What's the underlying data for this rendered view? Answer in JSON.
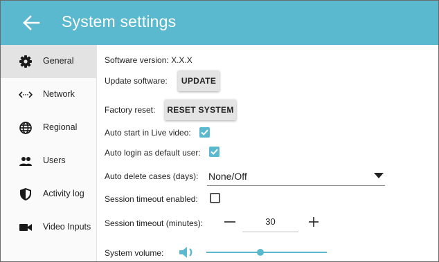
{
  "appbar": {
    "title": "System settings",
    "back_icon": "arrow-left-icon",
    "background": "#5ab8cf"
  },
  "sidebar": {
    "items": [
      {
        "label": "General",
        "icon": "gear-icon",
        "active": true
      },
      {
        "label": "Network",
        "icon": "code-dots-icon",
        "active": false
      },
      {
        "label": "Regional",
        "icon": "globe-icon",
        "active": false
      },
      {
        "label": "Users",
        "icon": "users-icon",
        "active": false
      },
      {
        "label": "Activity log",
        "icon": "shield-icon",
        "active": false
      },
      {
        "label": "Video Inputs",
        "icon": "video-camera-icon",
        "active": false
      }
    ]
  },
  "general": {
    "software_version_label": "Software version:",
    "software_version_value": "X.X.X",
    "update_label": "Update software:",
    "update_button": "UPDATE",
    "factory_reset_label": "Factory reset:",
    "reset_button": "RESET SYSTEM",
    "auto_start_label": "Auto start in Live video:",
    "auto_start_checked": true,
    "auto_login_label": "Auto login as default user:",
    "auto_login_checked": true,
    "auto_delete_label": "Auto delete cases (days):",
    "auto_delete_value": "None/Off",
    "session_timeout_enabled_label": "Session timeout enabled:",
    "session_timeout_enabled_checked": false,
    "session_timeout_minutes_label": "Session timeout (minutes):",
    "session_timeout_minutes_value": "30",
    "system_volume_label": "System volume:",
    "system_volume_level": 0.45
  },
  "colors": {
    "accent": "#5ab8cf",
    "active_nav": "#e3e3e3",
    "button": "#e4e4e4"
  }
}
